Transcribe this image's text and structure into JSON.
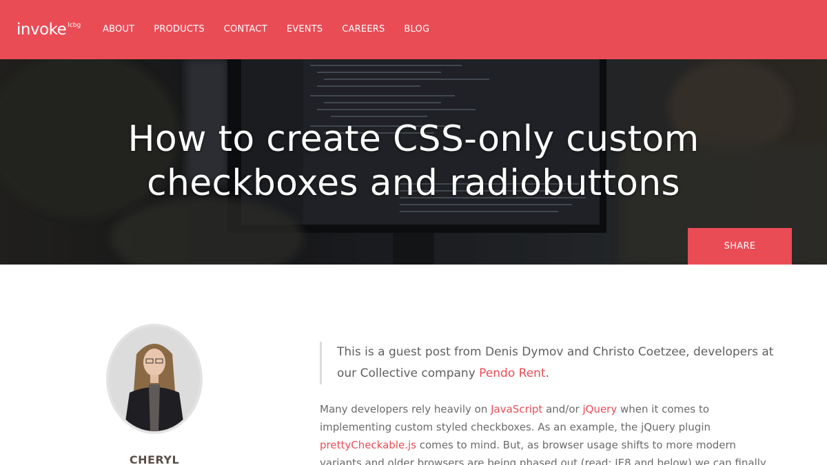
{
  "header": {
    "logo_text": "invoke",
    "logo_sub": "lcbg",
    "nav": [
      "ABOUT",
      "PRODUCTS",
      "CONTACT",
      "EVENTS",
      "CAREERS",
      "BLOG"
    ]
  },
  "hero": {
    "title_line1": "How to create CSS-only custom",
    "title_line2": "checkboxes and radiobuttons",
    "share_label": "SHARE"
  },
  "author": {
    "name": "CHERYL"
  },
  "article": {
    "intro_text": "This is a guest post from Denis Dymov and Christo Coetzee, developers at our Collective company ",
    "intro_link": "Pendo Rent",
    "intro_end": ".",
    "p1_a": "Many developers rely heavily on ",
    "p1_link1": "JavaScript",
    "p1_b": " and/or ",
    "p1_link2": "jQuery",
    "p1_c": " when it comes to implementing custom styled checkboxes. As an example, the jQuery plugin ",
    "p1_link3": "prettyCheckable.js",
    "p1_d": " comes to mind. But, as browser usage shifts to more modern variants and older browsers are being phased out (read: IE8 and below) we can finally"
  },
  "colors": {
    "accent": "#ea4c56",
    "text": "#5f5f5f"
  }
}
